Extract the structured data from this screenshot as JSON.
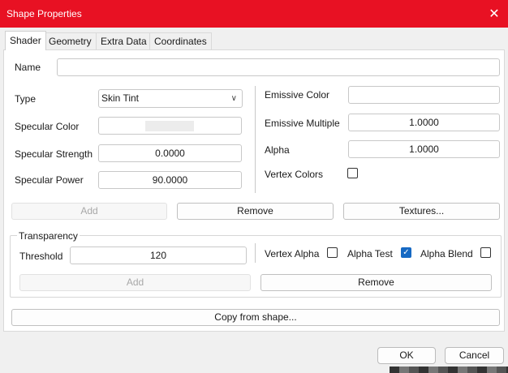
{
  "window": {
    "title": "Shape Properties"
  },
  "tabs": [
    {
      "label": "Shader"
    },
    {
      "label": "Geometry"
    },
    {
      "label": "Extra Data"
    },
    {
      "label": "Coordinates"
    }
  ],
  "shader": {
    "name_label": "Name",
    "name_value": "",
    "type_label": "Type",
    "type_value": "Skin Tint",
    "specular_color_label": "Specular Color",
    "specular_strength_label": "Specular Strength",
    "specular_strength_value": "0.0000",
    "specular_power_label": "Specular Power",
    "specular_power_value": "90.0000",
    "emissive_color_label": "Emissive Color",
    "emissive_multiple_label": "Emissive Multiple",
    "emissive_multiple_value": "1.0000",
    "alpha_label": "Alpha",
    "alpha_value": "1.0000",
    "vertex_colors_label": "Vertex Colors",
    "vertex_colors_checked": false
  },
  "actions": {
    "add": "Add",
    "remove": "Remove",
    "textures": "Textures..."
  },
  "transparency": {
    "legend": "Transparency",
    "threshold_label": "Threshold",
    "threshold_value": "120",
    "vertex_alpha_label": "Vertex Alpha",
    "vertex_alpha_checked": false,
    "alpha_test_label": "Alpha Test",
    "alpha_test_checked": true,
    "alpha_blend_label": "Alpha Blend",
    "alpha_blend_checked": false,
    "add": "Add",
    "remove": "Remove"
  },
  "copy_from_shape": "Copy from shape...",
  "footer": {
    "ok": "OK",
    "cancel": "Cancel"
  },
  "colors": {
    "titlebar": "#e81123",
    "checkbox_checked": "#1669c3"
  }
}
